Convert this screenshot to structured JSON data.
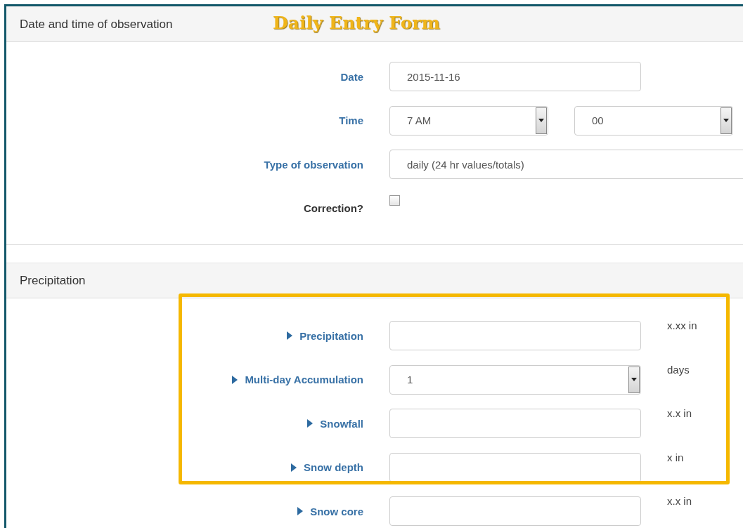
{
  "banner": "Daily Entry Form",
  "sections": [
    {
      "title": "Date and time of observation",
      "fields": [
        {
          "label": "Date",
          "kind": "text",
          "expandable": false,
          "value": "2015-11-16"
        },
        {
          "label": "Time",
          "kind": "selects",
          "expandable": false,
          "values": [
            "7 AM",
            "00"
          ]
        },
        {
          "label": "Type of observation",
          "kind": "wide",
          "expandable": false,
          "value": "daily (24 hr values/totals)"
        },
        {
          "label": "Correction?",
          "kind": "checkbox",
          "expandable": false,
          "checked": false
        }
      ]
    },
    {
      "title": "Precipitation",
      "fields": [
        {
          "label": "Precipitation",
          "kind": "text",
          "expandable": true,
          "unit": "x.xx in"
        },
        {
          "label": "Multi-day Accumulation",
          "kind": "select",
          "expandable": true,
          "value": "1",
          "unit": "days"
        },
        {
          "label": "Snowfall",
          "kind": "text",
          "expandable": true,
          "unit": "x.x in"
        },
        {
          "label": "Snow depth",
          "kind": "text",
          "expandable": true,
          "unit": "x in"
        },
        {
          "label": "Snow core",
          "kind": "text",
          "expandable": true,
          "unit": "x.x in"
        }
      ]
    }
  ]
}
